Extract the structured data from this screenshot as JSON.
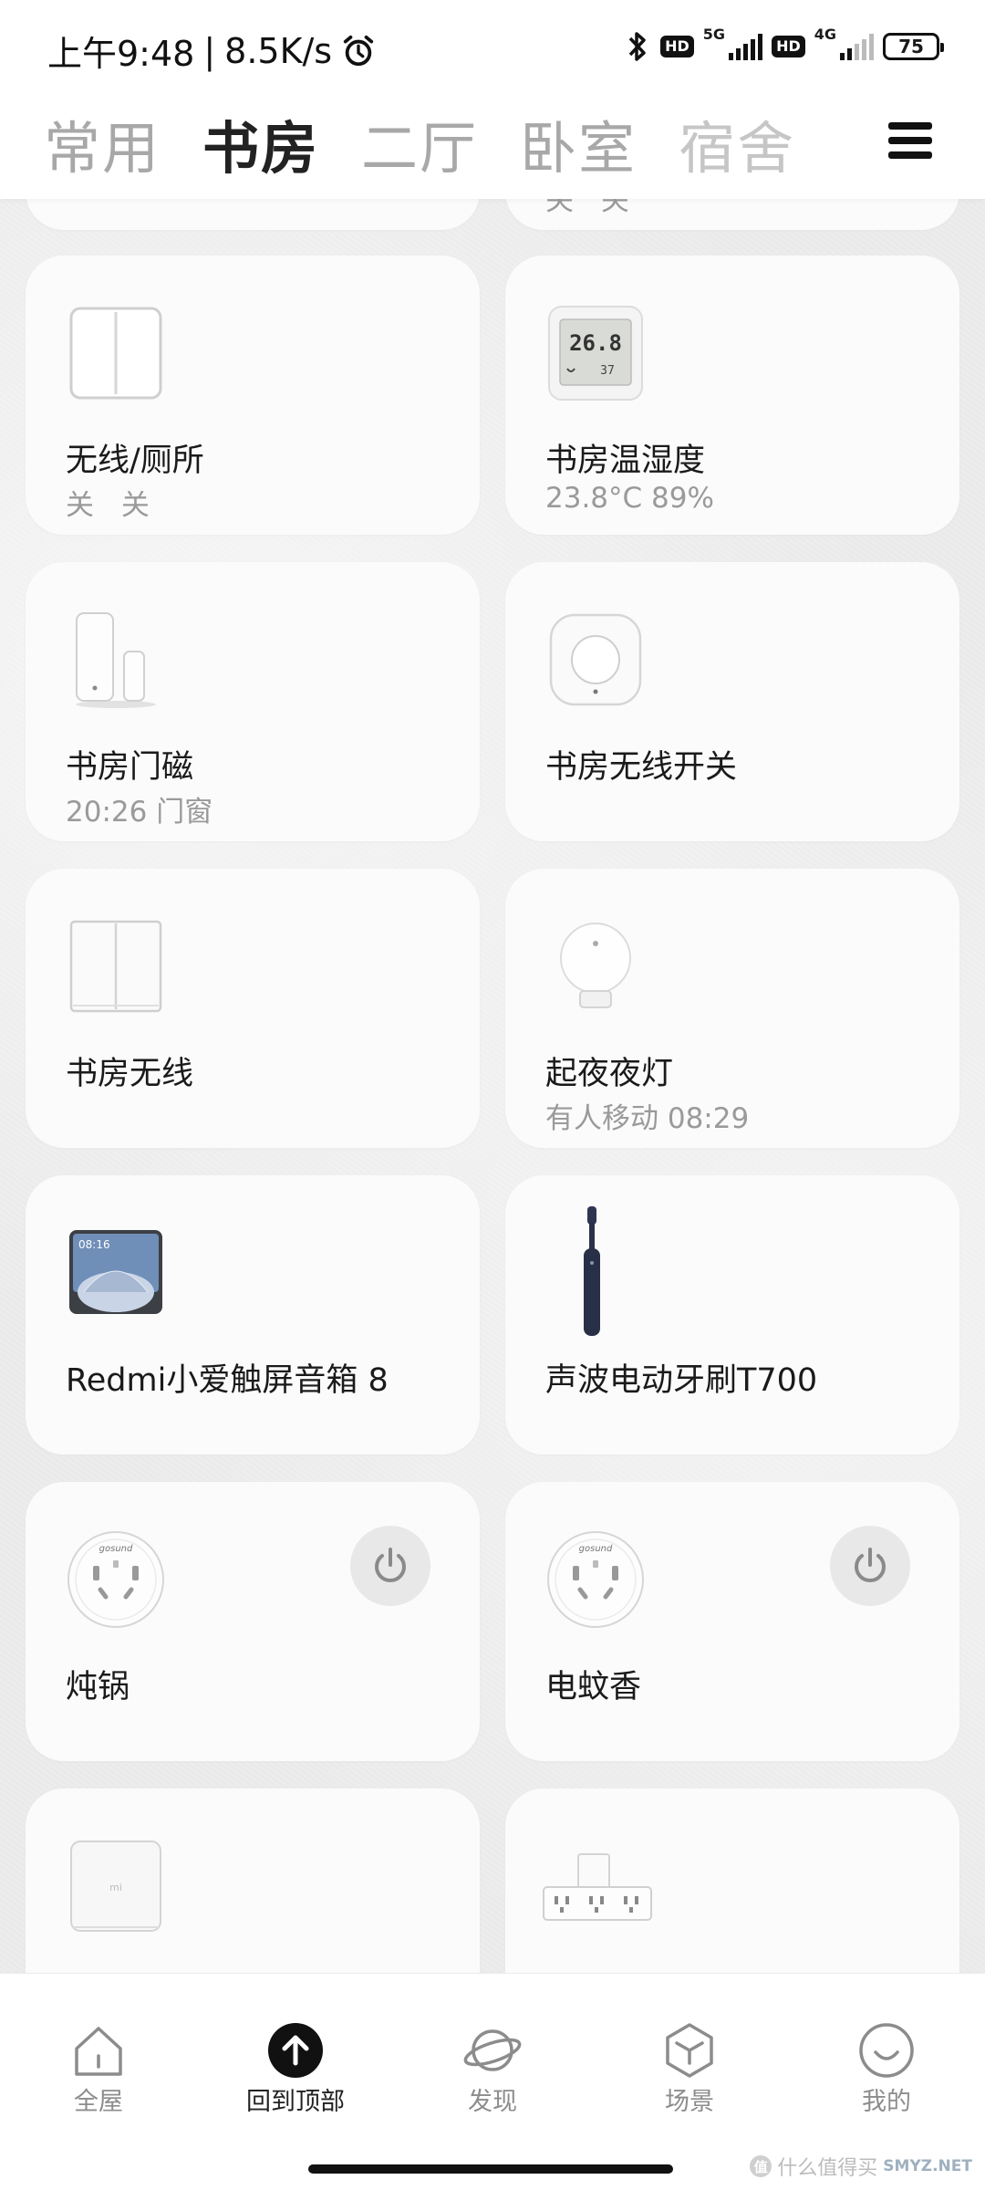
{
  "status_bar": {
    "time": "上午9:48",
    "net_speed": "8.5K/s",
    "separator": "|",
    "sim1_network": "5G",
    "sim2_network": "4G",
    "hd_label": "HD",
    "battery": "75"
  },
  "header": {
    "tabs": [
      {
        "label": "常用"
      },
      {
        "label": "书房"
      },
      {
        "label": "二厅"
      },
      {
        "label": "卧室"
      },
      {
        "label": "宿舍"
      }
    ]
  },
  "devices": [
    {
      "name": "",
      "status": ""
    },
    {
      "name": "",
      "status": "关 关"
    },
    {
      "name": "无线/厕所",
      "status": "关 关"
    },
    {
      "name": "书房温湿度",
      "status": "23.8°C 89%"
    },
    {
      "name": "书房门磁",
      "status": "20:26 门窗"
    },
    {
      "name": "书房无线开关",
      "status": ""
    },
    {
      "name": "书房无线",
      "status": ""
    },
    {
      "name": "起夜夜灯",
      "status": "有人移动 08:29"
    },
    {
      "name": "Redmi小爱触屏音箱 8",
      "status": ""
    },
    {
      "name": "声波电动牙刷T700",
      "status": ""
    },
    {
      "name": "炖锅",
      "status": ""
    },
    {
      "name": "电蚊香",
      "status": ""
    },
    {
      "name": "",
      "status": ""
    },
    {
      "name": "",
      "status": ""
    }
  ],
  "device_icons": {
    "thermometer_temp": "26.8",
    "thermometer_hum": "37",
    "speaker_time": "08:16",
    "plug_brand": "gosund",
    "gateway_logo": "mi"
  },
  "bottom_nav": [
    {
      "label": "全屋",
      "icon": "house-icon"
    },
    {
      "label": "回到顶部",
      "icon": "arrow-up-icon"
    },
    {
      "label": "发现",
      "icon": "planet-icon"
    },
    {
      "label": "场景",
      "icon": "cube-icon"
    },
    {
      "label": "我的",
      "icon": "smiley-icon"
    }
  ],
  "watermark": {
    "text": "什么值得买",
    "badge": "值",
    "url": "SMYZ.NET"
  },
  "colors": {
    "accent_dark": "#111111",
    "inactive_tab": "#a8a8a8",
    "status_grey": "#9a9a9a",
    "card_bg": "#fbfbfb",
    "page_bg": "#ececec"
  }
}
